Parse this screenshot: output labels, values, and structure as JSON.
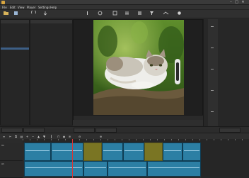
{
  "window": {
    "title": "",
    "min_glyph": "–",
    "max_glyph": "□",
    "close_glyph": "✕"
  },
  "menu": [
    "File",
    "Edit",
    "View",
    "Player",
    "Settings",
    "Help"
  ],
  "toolbar": {
    "buttons": [
      {
        "icon": "open-file-icon",
        "label": ""
      },
      {
        "icon": "save-icon",
        "label": ""
      },
      {
        "icon": "undo-icon",
        "label": ""
      },
      {
        "icon": "redo-icon",
        "label": ""
      },
      {
        "icon": "peak-meter-icon",
        "label": ""
      },
      {
        "icon": "properties-icon",
        "label": ""
      },
      {
        "icon": "recent-icon",
        "label": ""
      },
      {
        "icon": "playlist-icon",
        "label": ""
      },
      {
        "icon": "history-icon",
        "label": ""
      },
      {
        "icon": "filters-icon",
        "label": ""
      },
      {
        "icon": "timeline-icon",
        "label": ""
      },
      {
        "icon": "export-icon",
        "label": ""
      }
    ]
  },
  "left_panel": {
    "title": "",
    "rows": [
      "",
      "",
      "",
      "",
      "",
      "",
      "",
      "",
      "",
      "",
      "",
      "",
      "",
      "",
      "",
      "",
      "",
      "",
      "",
      "",
      "",
      "",
      "",
      "",
      "",
      "",
      "",
      "",
      "",
      "",
      "",
      "",
      "",
      ""
    ]
  },
  "info_panel": {
    "title": "",
    "lines": [
      "",
      "",
      "",
      "",
      "",
      "",
      "",
      ""
    ]
  },
  "player": {
    "transport_time": "",
    "end_time": ""
  },
  "bottom_tabs": [
    "",
    "",
    "",
    "",
    ""
  ],
  "timeline": {
    "tracks": [
      {
        "name": "V1"
      },
      {
        "name": "A1"
      }
    ],
    "clips_v1": [
      {
        "type": "clip",
        "caption": ""
      },
      {
        "type": "clip",
        "caption": ""
      },
      {
        "type": "gap",
        "caption": ""
      },
      {
        "type": "clip",
        "caption": ""
      },
      {
        "type": "clip",
        "caption": ""
      },
      {
        "type": "gap",
        "caption": ""
      },
      {
        "type": "clip",
        "caption": ""
      },
      {
        "type": "clip",
        "caption": ""
      }
    ]
  },
  "colors": {
    "accent": "#3d5f86",
    "clip_blue": "#2c7fa4",
    "gap_olive": "#7a7523",
    "playhead": "#dd3333"
  }
}
